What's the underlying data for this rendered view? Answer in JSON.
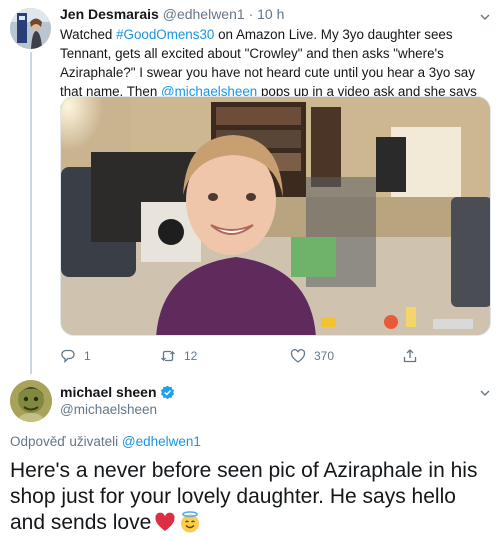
{
  "tweet1": {
    "author_name": "Jen Desmarais",
    "handle": "@edhelwen1",
    "separator": "·",
    "time": "10 h",
    "text_parts": {
      "p1": "Watched ",
      "hashtag": "#GoodOmens30",
      "p2": " on Amazon Live. My 3yo daughter sees Tennant, gets all excited about \"Crowley\" and then asks \"where's Aziraphale?\" I swear you have not heard cute until you hear a 3yo say that name. Then ",
      "mention": "@michaelsheen",
      "p3": " pops up in a video ask and she says \"there's Aziraphale!\""
    },
    "actions": {
      "reply_count": "1",
      "retweet_count": "12",
      "like_count": "370"
    }
  },
  "reply_tweet": {
    "author_name": "michael sheen",
    "handle": "@michaelsheen",
    "replying_to_label": "Odpověď uživateli ",
    "replying_to_handle": "@edhelwen1",
    "text": "Here's a never before seen pic of Aziraphale in his shop just for your lovely daughter. He says hello and sends love"
  },
  "icons": {
    "reply": "reply-icon",
    "retweet": "retweet-icon",
    "like": "heart-icon",
    "share": "share-icon",
    "verified": "verified-badge-icon",
    "more": "chevron-down-icon",
    "emoji1": "red-heart-emoji",
    "emoji2": "smiling-face-with-halo-emoji"
  },
  "colors": {
    "link": "#1b95e0",
    "secondary_text": "#657786",
    "primary_text": "#14171a",
    "verified": "#1da1f2",
    "thread_line": "#ccd6dd"
  }
}
